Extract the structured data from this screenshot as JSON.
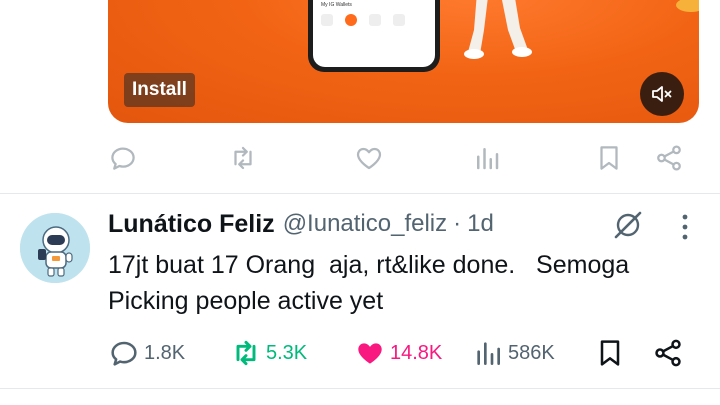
{
  "ad": {
    "install_label": "Install",
    "phone_header": "My IG Wallets",
    "icons": {
      "sparkle": "sparkle-icon",
      "mute": "speaker-muted-icon"
    }
  },
  "ad_actions": {
    "icons": [
      "reply-icon",
      "retweet-icon",
      "like-icon",
      "views-icon",
      "bookmark-icon",
      "share-icon"
    ]
  },
  "tweet": {
    "display_name": "Lunático Feliz",
    "handle": "@Iunatico_feliz",
    "separator": "·",
    "time": "1d",
    "text": "17jt buat 17 Orang  aja, rt&like done.   Semoga Picking people active yet",
    "stats": {
      "replies": "1.8K",
      "retweets": "5.3K",
      "likes": "14.8K",
      "views": "586K"
    }
  },
  "colors": {
    "ad_orange": "#f26414",
    "retweet_green": "#00ba7c",
    "like_pink": "#f91880",
    "muted_text": "#536471",
    "text": "#0f1419"
  }
}
